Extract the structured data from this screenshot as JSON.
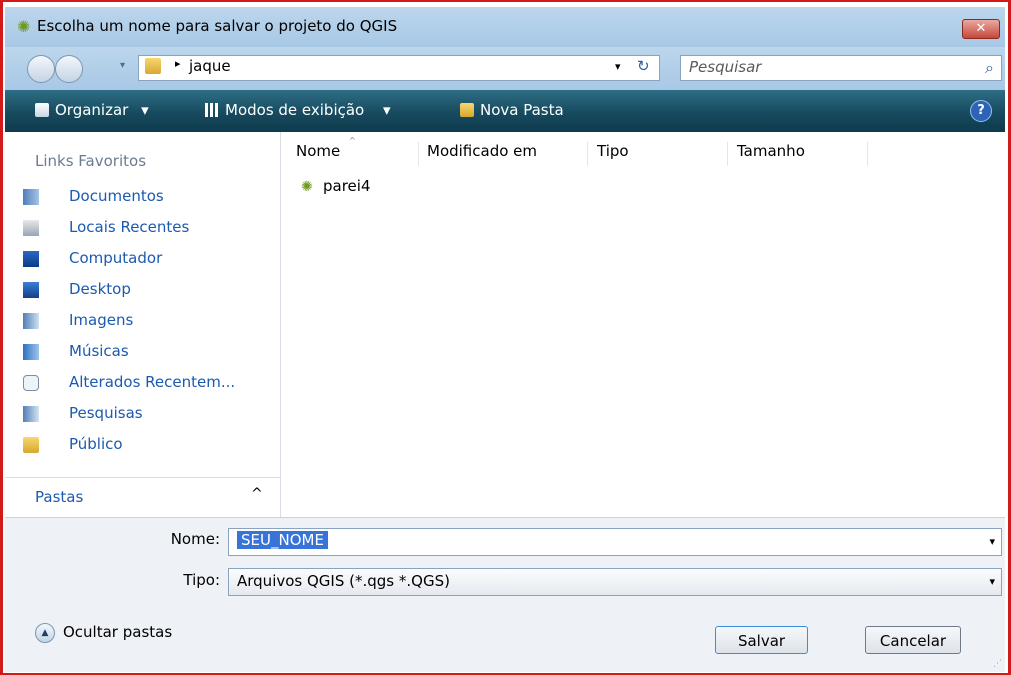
{
  "window": {
    "title": "Escolha um nome para salvar o projeto do QGIS",
    "close_label": "✕",
    "app_icon": "qgis-icon"
  },
  "address": {
    "crumb_arrow": "▸",
    "current_folder": "jaque",
    "dropdown_glyph": "▾",
    "refresh_glyph": "↻",
    "search_placeholder": "Pesquisar",
    "search_glyph": "⌕"
  },
  "toolbar": {
    "organize_label": "Organizar",
    "views_label": "Modos de exibição",
    "new_folder_label": "Nova Pasta",
    "dropdown_glyph": "▾",
    "help_glyph": "?"
  },
  "sidebar": {
    "heading": "Links Favoritos",
    "items": [
      {
        "label": "Documentos",
        "icon": "documents-icon"
      },
      {
        "label": "Locais Recentes",
        "icon": "recent-places-icon"
      },
      {
        "label": "Computador",
        "icon": "computer-icon"
      },
      {
        "label": "Desktop",
        "icon": "desktop-icon"
      },
      {
        "label": "Imagens",
        "icon": "pictures-icon"
      },
      {
        "label": "Músicas",
        "icon": "music-icon"
      },
      {
        "label": "Alterados Recentem...",
        "icon": "recently-changed-icon"
      },
      {
        "label": "Pesquisas",
        "icon": "searches-icon"
      },
      {
        "label": "Público",
        "icon": "public-folder-icon"
      }
    ],
    "folders_label": "Pastas",
    "folders_chevron": "^"
  },
  "file_list": {
    "columns": [
      "Nome",
      "Modificado em",
      "Tipo",
      "Tamanho"
    ],
    "sort_glyph": "^",
    "files": [
      {
        "name": "parei4",
        "icon": "qgis-file-icon"
      }
    ]
  },
  "form": {
    "name_label": "Nome:",
    "name_value": "SEU_NOME",
    "type_label": "Tipo:",
    "type_value": "Arquivos QGIS (*.qgs *.QGS)",
    "dropdown_glyph": "▾"
  },
  "footer": {
    "hide_folders_label": "Ocultar pastas",
    "hide_folders_glyph": "▲",
    "save_label": "Salvar",
    "cancel_label": "Cancelar",
    "grip_glyph": "⋰"
  },
  "colors": {
    "frame_border": "#d21a1a",
    "toolbar_bg": "#174a5e",
    "link": "#1c5ab0",
    "selection": "#3874d8"
  }
}
